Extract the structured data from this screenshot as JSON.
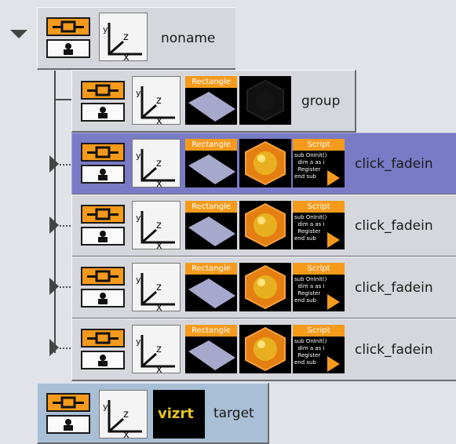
{
  "tree": {
    "root": {
      "label": "noname"
    },
    "children": [
      {
        "label": "group",
        "thumbs": [
          "rectangle",
          "material-dark"
        ]
      },
      {
        "label": "click_fadein",
        "thumbs": [
          "rectangle",
          "material-orange",
          "script"
        ],
        "selected": true
      },
      {
        "label": "click_fadein",
        "thumbs": [
          "rectangle",
          "material-orange",
          "script"
        ]
      },
      {
        "label": "click_fadein",
        "thumbs": [
          "rectangle",
          "material-orange",
          "script"
        ]
      },
      {
        "label": "click_fadein",
        "thumbs": [
          "rectangle",
          "material-orange",
          "script"
        ]
      }
    ],
    "sibling": {
      "label": "target",
      "thumbs": [
        "vizrt-logo"
      ]
    }
  },
  "captions": {
    "rectangle": "Rectangle",
    "script": "Script"
  },
  "script_preview": "sub OnInit()\n  dim a as i\n  Register\nend sub",
  "axis_labels": {
    "y": "y",
    "z": "z",
    "x": "x"
  },
  "logo_text": "vizrt",
  "colors": {
    "accent": "#f59a1a",
    "selected": "#7a7bc6",
    "row": "#d6d7dc",
    "target": "#a9bfd6"
  }
}
